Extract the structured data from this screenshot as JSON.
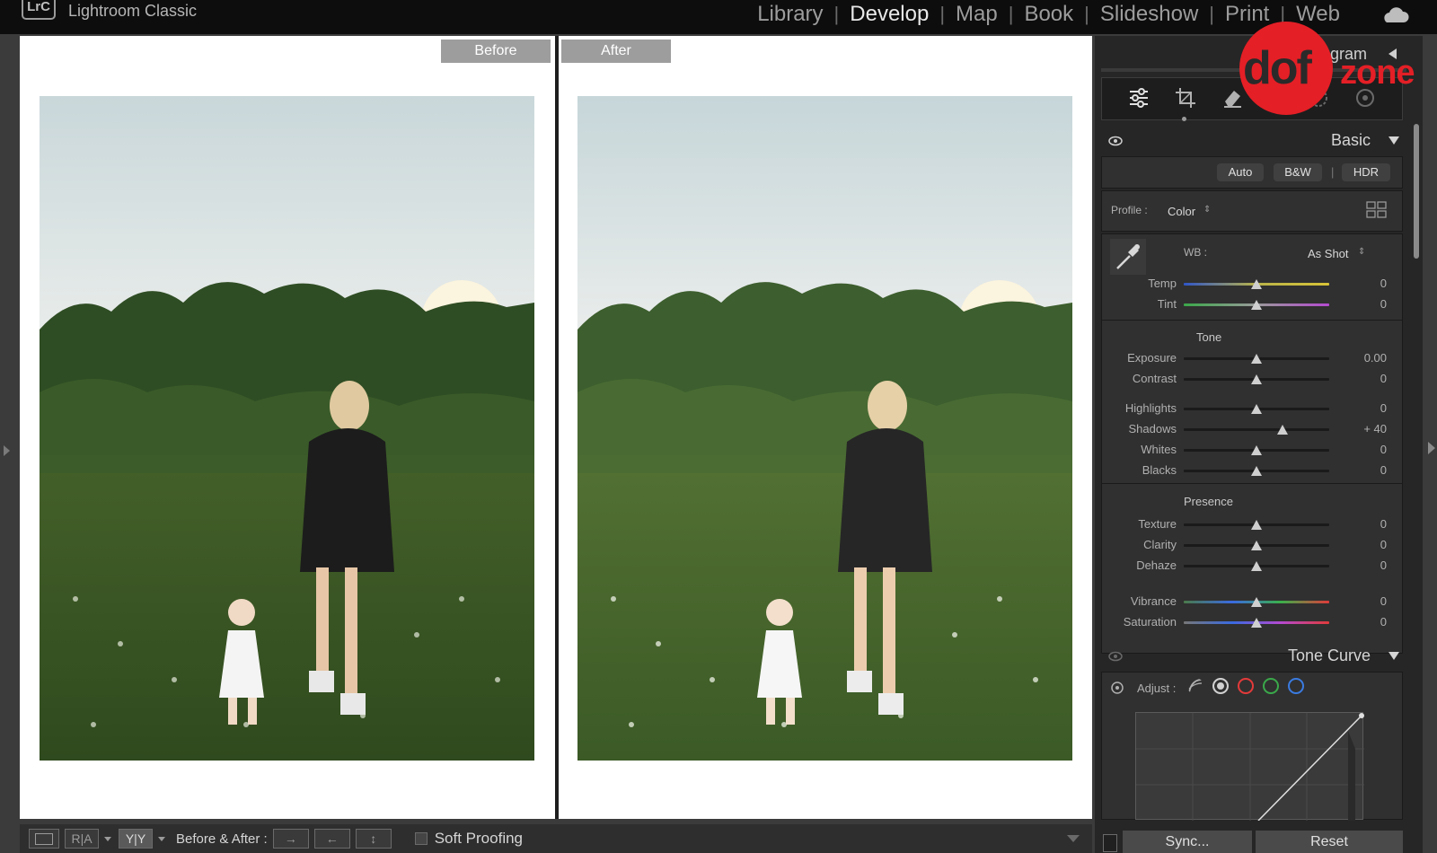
{
  "app": {
    "badge": "LrC",
    "name": "Lightroom Classic"
  },
  "modules": [
    {
      "label": "Library"
    },
    {
      "label": "Develop"
    },
    {
      "label": "Map"
    },
    {
      "label": "Book"
    },
    {
      "label": "Slideshow"
    },
    {
      "label": "Print"
    },
    {
      "label": "Web"
    }
  ],
  "active_module": "Develop",
  "viewer": {
    "before_label": "Before",
    "after_label": "After"
  },
  "toolbar": {
    "view_ab": "R|A",
    "view_yy": "Y|Y",
    "before_after_label": "Before & After :",
    "soft_proofing_label": "Soft Proofing"
  },
  "panel": {
    "histogram_label": "Histogram",
    "watermark": {
      "part1": "dof",
      "part2": "zone"
    },
    "basic": {
      "title": "Basic",
      "treatments": [
        "Auto",
        "B&W",
        "HDR"
      ],
      "profile_label": "Profile :",
      "profile_value": "Color",
      "wb_label": "WB :",
      "wb_value": "As Shot",
      "tone_label": "Tone",
      "presence_label": "Presence",
      "sliders": [
        {
          "name": "Temp",
          "value": "0",
          "position": 0.5
        },
        {
          "name": "Tint",
          "value": "0",
          "position": 0.5
        },
        {
          "name": "Exposure",
          "value": "0.00",
          "position": 0.5
        },
        {
          "name": "Contrast",
          "value": "0",
          "position": 0.5
        },
        {
          "name": "Highlights",
          "value": "0",
          "position": 0.5
        },
        {
          "name": "Shadows",
          "value": "+ 40",
          "position": 0.68
        },
        {
          "name": "Whites",
          "value": "0",
          "position": 0.5
        },
        {
          "name": "Blacks",
          "value": "0",
          "position": 0.5
        },
        {
          "name": "Texture",
          "value": "0",
          "position": 0.5
        },
        {
          "name": "Clarity",
          "value": "0",
          "position": 0.5
        },
        {
          "name": "Dehaze",
          "value": "0",
          "position": 0.5
        },
        {
          "name": "Vibrance",
          "value": "0",
          "position": 0.5
        },
        {
          "name": "Saturation",
          "value": "0",
          "position": 0.5
        }
      ]
    },
    "tone_curve": {
      "title": "Tone Curve",
      "adjust_label": "Adjust :"
    },
    "sync_label": "Sync...",
    "reset_label": "Reset"
  },
  "colors": {
    "brand_red": "#e41f26",
    "panel_bg": "#262626",
    "active_module": "#e8e8e8"
  }
}
